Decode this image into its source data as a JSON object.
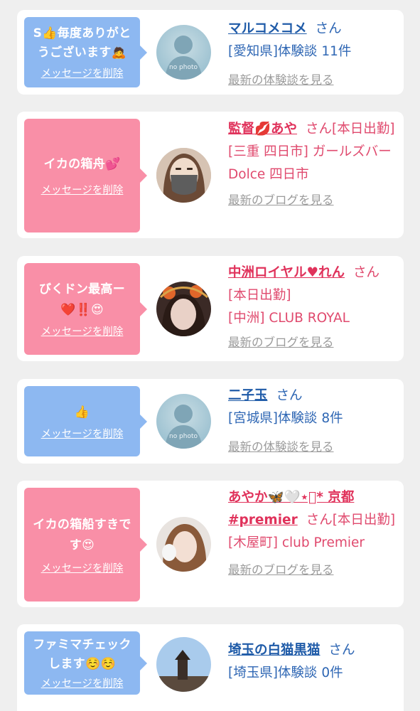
{
  "entries": [
    {
      "type": "review",
      "message": "S👍毎度ありがとうございます🙇",
      "delete_label": "メッセージを削除",
      "avatar": "no-photo",
      "avatar_text": "no photo",
      "name": "マルコメコメ",
      "san": "さん",
      "line1": "[愛知県]体験談 11件",
      "line2": "",
      "link": "最新の体験談を見る"
    },
    {
      "type": "blog",
      "message": "イカの箱舟💕",
      "delete_label": "メッセージを削除",
      "avatar": "photo",
      "name": "監督💋あや",
      "san": "さん[本日出勤]",
      "line1": "[三重 四日市] ガールズバー Dolce 四日市",
      "line2": "",
      "link": "最新のブログを見る"
    },
    {
      "type": "blog",
      "message": "びくドン最高ー❤️‼️😍",
      "delete_label": "メッセージを削除",
      "avatar": "photo",
      "name": "中洲ロイヤル♥れん",
      "san": "さん",
      "line1": "[本日出勤]",
      "line2": "[中洲] CLUB ROYAL",
      "link": "最新のブログを見る"
    },
    {
      "type": "review",
      "message": "👍",
      "delete_label": "メッセージを削除",
      "avatar": "no-photo",
      "avatar_text": "no photo",
      "name": "二子玉",
      "san": "さん",
      "line1": "[宮城県]体験談 8件",
      "line2": "",
      "link": "最新の体験談を見る"
    },
    {
      "type": "blog",
      "message": "イカの箱船すきです😍",
      "delete_label": "メッセージを削除",
      "avatar": "photo",
      "name": "あやか🦋🤍⋆͛* 京都 #premier",
      "san": "さん[本日出勤]",
      "line1": "[木屋町] club Premier",
      "line2": "",
      "link": "最新のブログを見る"
    },
    {
      "type": "review",
      "message": "ファミマチェックします☺️☺️",
      "delete_label": "メッセージを削除",
      "avatar": "photo",
      "name": "埼玉の白猫黒猫",
      "san": "さん",
      "line1": "[埼玉県]体験談 0件",
      "line2": "",
      "link": ""
    }
  ],
  "colors": {
    "review_bubble": "#8db8f1",
    "blog_bubble": "#f98fa7",
    "review_text": "#2f67b4",
    "blog_text": "#e04a6e"
  }
}
